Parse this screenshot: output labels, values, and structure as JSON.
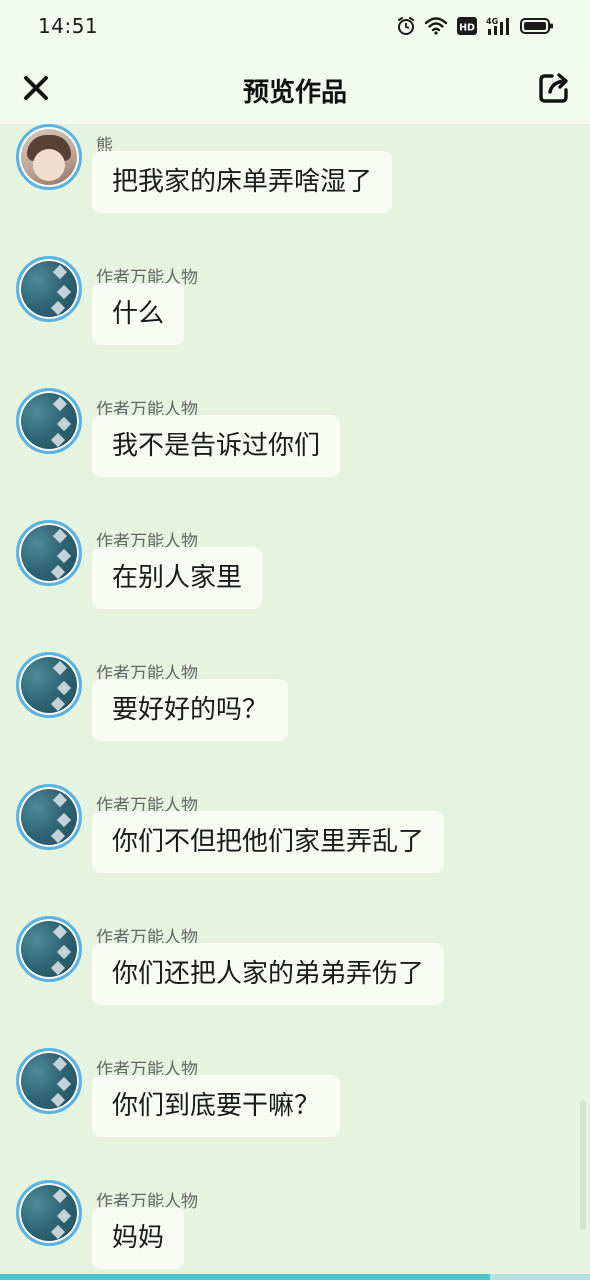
{
  "status_bar": {
    "time": "14:51",
    "icons": [
      "alarm-icon",
      "wifi-icon",
      "hd-icon",
      "4g-signal-icon",
      "battery-icon"
    ],
    "network_label": "4G",
    "hd_label": "HD"
  },
  "header": {
    "title": "预览作品",
    "close_icon": "close-icon",
    "share_icon": "share-icon"
  },
  "colors": {
    "background": "#e6f3de",
    "header_background": "#f3fbef",
    "bubble": "#f7fbf4",
    "avatar_ring": "#5ab3e6",
    "progress": "#4fc6cf"
  },
  "messages": [
    {
      "sender": "熊",
      "text": "把我家的床单弄啥湿了",
      "avatar": "user-avatar"
    },
    {
      "sender": "作者万能人物",
      "text": "什么",
      "avatar": "author-avatar"
    },
    {
      "sender": "作者万能人物",
      "text": "我不是告诉过你们",
      "avatar": "author-avatar"
    },
    {
      "sender": "作者万能人物",
      "text": "在别人家里",
      "avatar": "author-avatar"
    },
    {
      "sender": "作者万能人物",
      "text": "要好好的吗？",
      "avatar": "author-avatar"
    },
    {
      "sender": "作者万能人物",
      "text": "你们不但把他们家里弄乱了",
      "avatar": "author-avatar"
    },
    {
      "sender": "作者万能人物",
      "text": "你们还把人家的弟弟弄伤了",
      "avatar": "author-avatar"
    },
    {
      "sender": "作者万能人物",
      "text": "你们到底要干嘛？",
      "avatar": "author-avatar"
    },
    {
      "sender": "作者万能人物",
      "text": "妈妈",
      "avatar": "author-avatar"
    }
  ],
  "progress": {
    "fraction": 0.83
  }
}
